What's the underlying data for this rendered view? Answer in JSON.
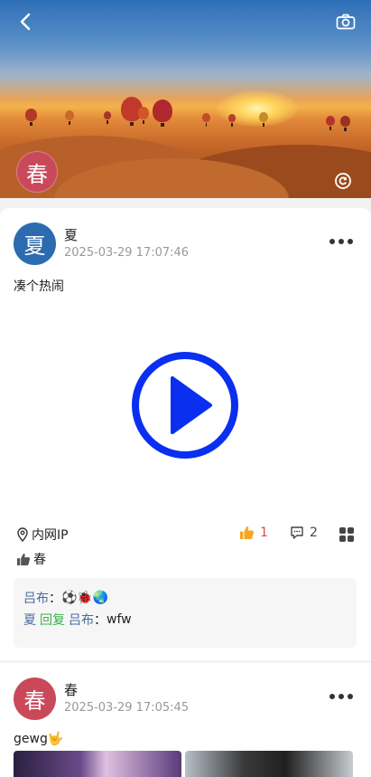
{
  "cover": {
    "avatar_char": "春",
    "icons": {
      "back": "back-chevron-icon",
      "camera": "camera-icon",
      "refresh": "refresh-icon"
    }
  },
  "posts": [
    {
      "avatar_char": "夏",
      "avatar_color": "#2d6bb0",
      "author": "夏",
      "time": "2025-03-29 17:07:46",
      "content": "凑个热闹",
      "media": "video",
      "location": "内网IP",
      "likes": "1",
      "comments_count": "2",
      "liked_by": "春",
      "comments": [
        {
          "from": "吕布",
          "sep": "：",
          "text": "⚽🐞🌏"
        },
        {
          "from": "夏",
          "reply_label": "回复",
          "to": "吕布",
          "sep": "：",
          "text": "wfw"
        }
      ]
    },
    {
      "avatar_char": "春",
      "avatar_color": "#c9495a",
      "author": "春",
      "time": "2025-03-29 17:05:45",
      "content": "gewg🤟"
    }
  ],
  "colors": {
    "play": "#0a2ff0",
    "like": "#f5a623",
    "reply": "#3ab04a",
    "name": "#4a6aa0"
  }
}
